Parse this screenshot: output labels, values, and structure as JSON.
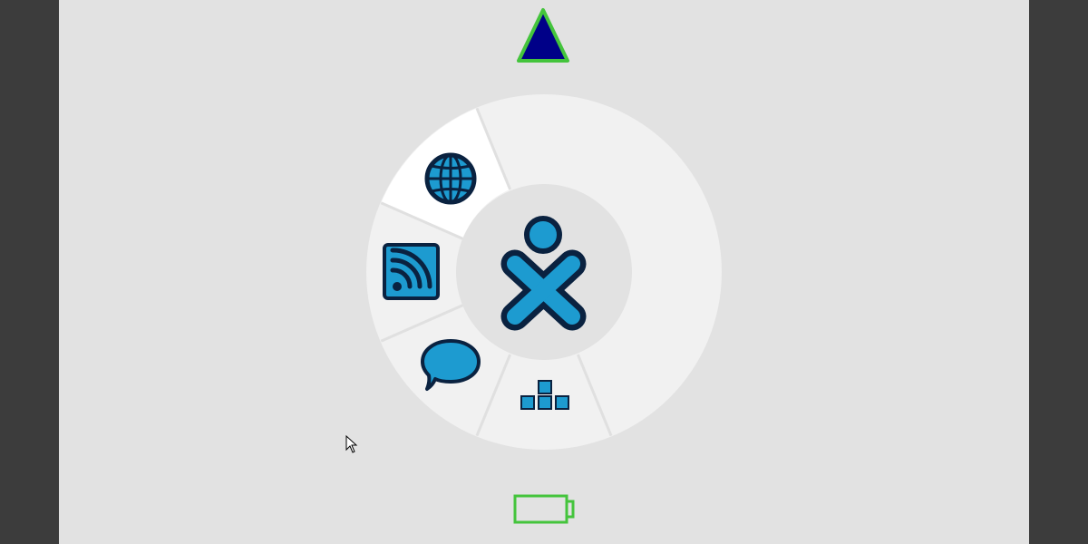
{
  "colors": {
    "frame": "#3c3c3c",
    "desktop": "#e2e2e2",
    "ring": "#f1f1f1",
    "ring_active": "#ffffff",
    "center": "#e2e2e2",
    "divider": "#e0e0e0",
    "icon_fill": "#1d9bd0",
    "icon_stroke": "#0a2240",
    "network_fill": "#000088",
    "network_stroke": "#44c43c",
    "battery_stroke": "#44c43c"
  },
  "network_indicator": {
    "icon": "triangle-network-icon"
  },
  "home_ring": {
    "center": {
      "icon": "xo-user-icon"
    },
    "activities": [
      {
        "id": "browse",
        "icon": "globe-icon",
        "active": true
      },
      {
        "id": "news-reader",
        "icon": "rss-feed-icon",
        "active": false
      },
      {
        "id": "chat",
        "icon": "speech-bubble-icon",
        "active": false
      },
      {
        "id": "blocks",
        "icon": "blocks-icon",
        "active": false
      }
    ]
  },
  "battery_indicator": {
    "icon": "battery-icon",
    "level": 0
  },
  "cursor": {
    "icon": "mouse-pointer-icon"
  }
}
